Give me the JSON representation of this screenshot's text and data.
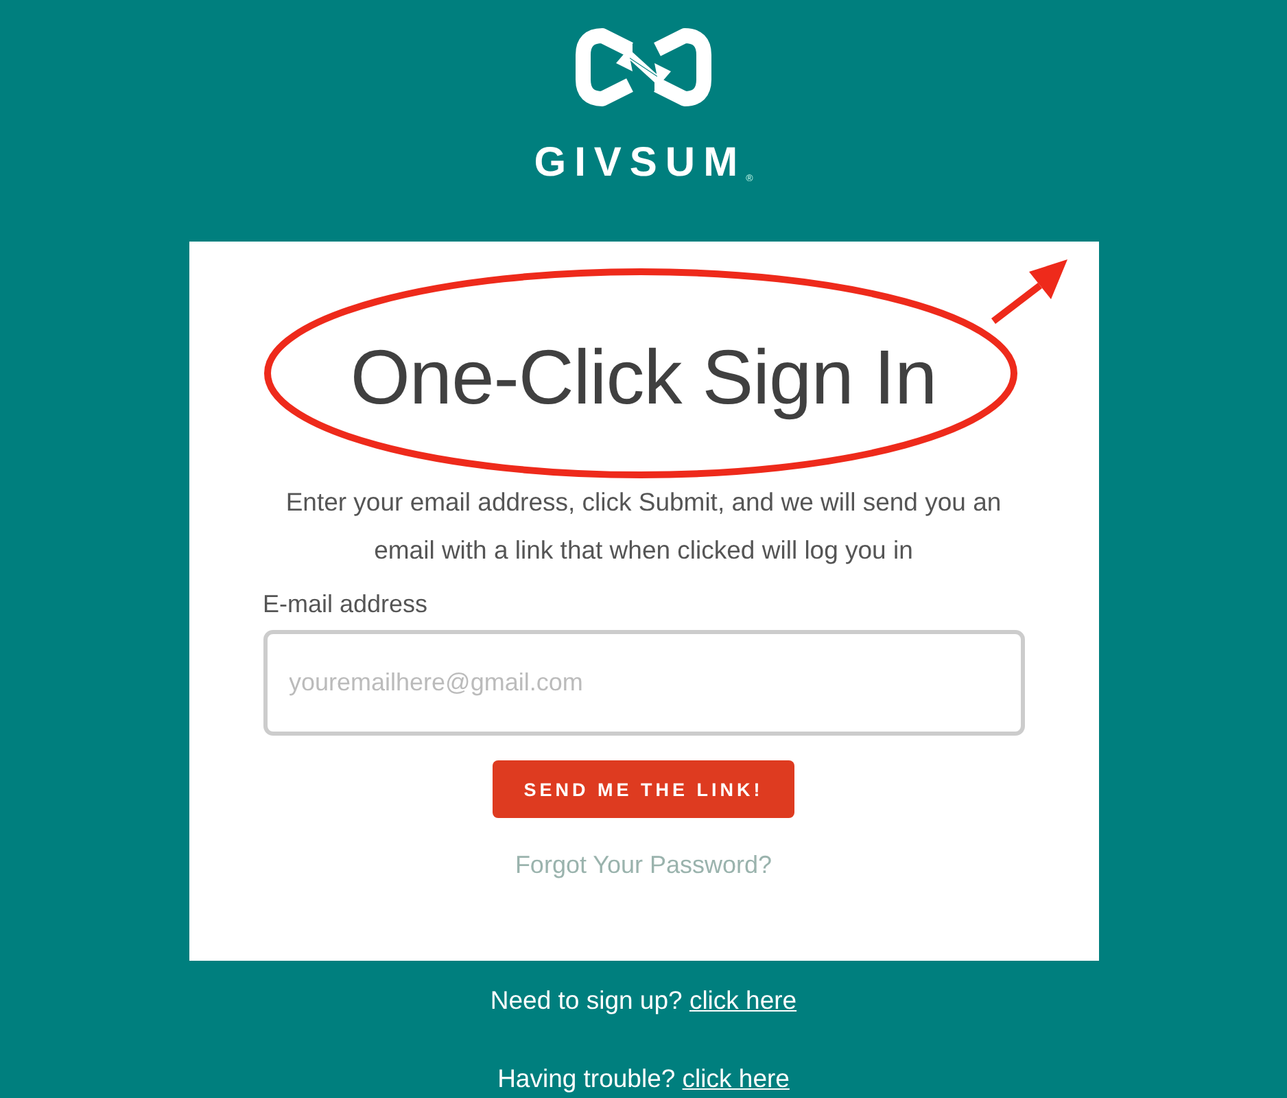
{
  "brand": {
    "name": "GIVSUM",
    "mark": "®"
  },
  "card": {
    "title": "One-Click Sign In",
    "description": "Enter your email address, click Submit, and we will send you an email with a link that when clicked will log you in",
    "email_field": {
      "label": "E-mail address",
      "placeholder": "youremailhere@gmail.com"
    },
    "submit_button": "SEND ME THE LINK!",
    "forgot_link": "Forgot Your Password?"
  },
  "highlight_ellipse": {
    "color": "#ee2a1b"
  },
  "pointer_arrow": {
    "color": "#ee2a1b"
  },
  "footer": [
    {
      "text": "Need to sign up?",
      "link": "click here"
    },
    {
      "text": "Having trouble?",
      "link": "click here"
    }
  ]
}
